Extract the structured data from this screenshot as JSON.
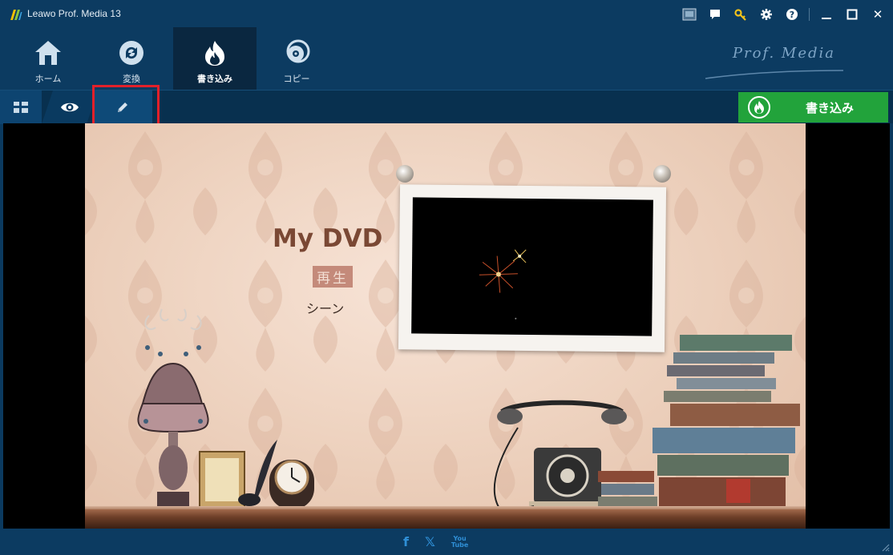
{
  "window": {
    "title": "Leawo Prof. Media 13",
    "controls": {
      "close_glyph": "✕"
    }
  },
  "nav": {
    "items": [
      {
        "label": "ホーム",
        "icon": "home-icon"
      },
      {
        "label": "変換",
        "icon": "convert-icon"
      },
      {
        "label": "書き込み",
        "icon": "burn-flame-icon",
        "active": true
      },
      {
        "label": "コピー",
        "icon": "copy-disc-icon"
      }
    ],
    "brand": "Prof. Media"
  },
  "toolbar": {
    "burn_label": "書き込み"
  },
  "menu": {
    "title": "My DVD",
    "play_label": "再生",
    "scene_label": "シーン"
  },
  "footer": {
    "facebook": "f",
    "x": "𝕏",
    "youtube_top": "You",
    "youtube_bottom": "Tube"
  },
  "colors": {
    "titlebar_bg": "#0c3b61",
    "toolbar_bg": "#08304f",
    "burn_button": "#22a33b",
    "highlight": "#e3202a",
    "title_text": "#7a4834"
  }
}
